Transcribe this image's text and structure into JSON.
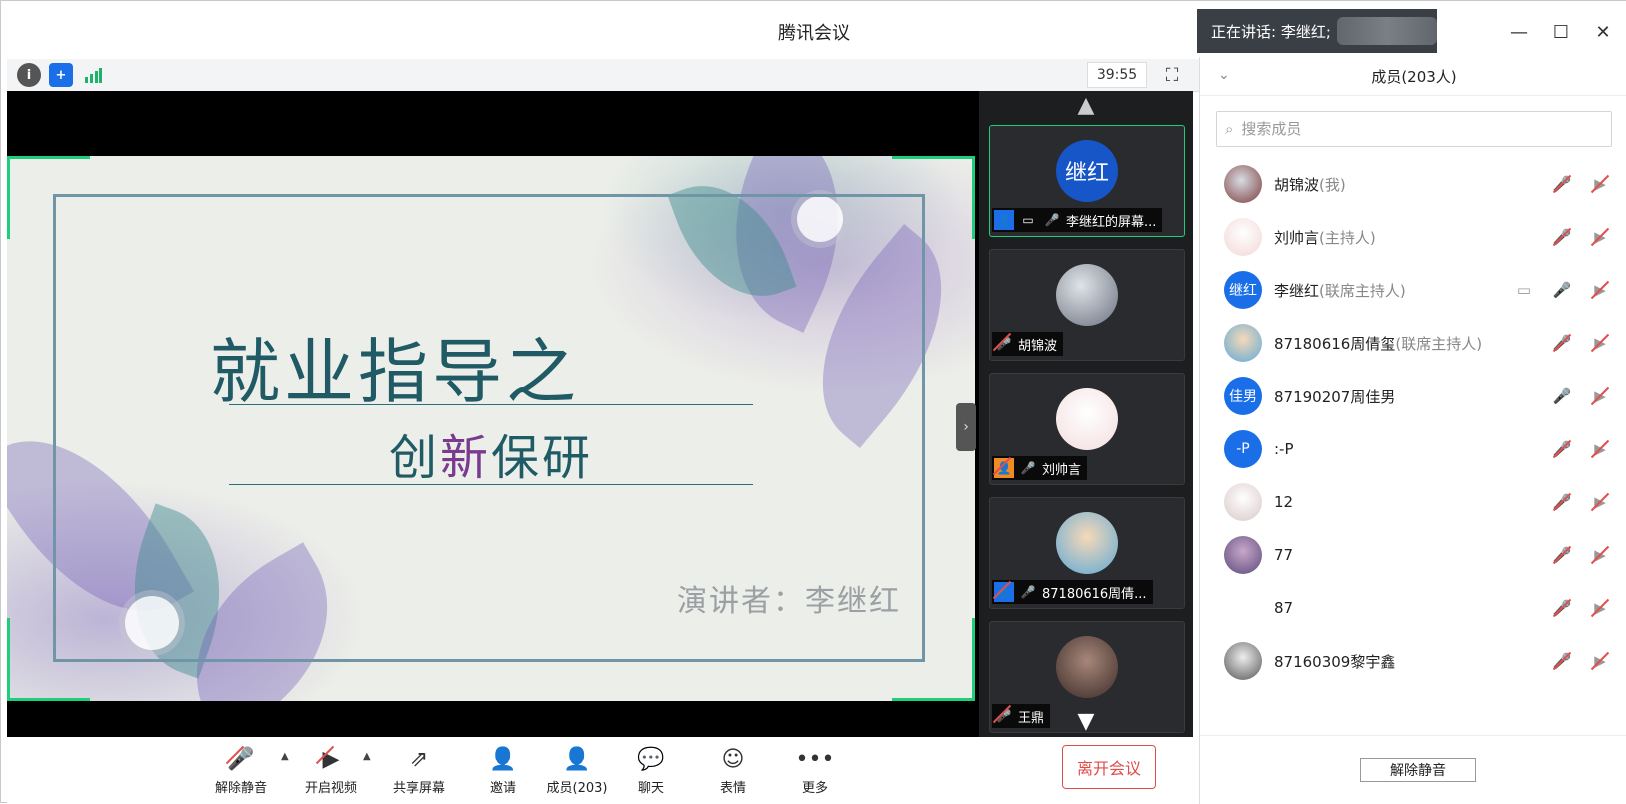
{
  "app": {
    "title": "腾讯会议"
  },
  "speaking": {
    "label": "正在讲话: 李继红;"
  },
  "toolbar": {
    "timer": "39:55"
  },
  "slide": {
    "title": "就业指导之",
    "subtitle_a": "创",
    "subtitle_accent": "新",
    "subtitle_b": "保研",
    "presenter": "演讲者：李继红"
  },
  "gallery": {
    "tiles": [
      {
        "avatar_text": "继红",
        "label": "李继红的屏幕..."
      },
      {
        "avatar_text": "",
        "label": "胡锦波"
      },
      {
        "avatar_text": "",
        "label": "刘帅言"
      },
      {
        "avatar_text": "",
        "label": "87180616周倩..."
      },
      {
        "avatar_text": "",
        "label": "王鼎"
      }
    ]
  },
  "panel": {
    "title": "成员(203人)",
    "search_placeholder": "搜索成员",
    "members": [
      {
        "avatar_text": "",
        "name": "胡锦波",
        "role": "(我)"
      },
      {
        "avatar_text": "",
        "name": "刘帅言",
        "role": "(主持人)"
      },
      {
        "avatar_text": "继红",
        "name": "李继红",
        "role": "(联席主持人)"
      },
      {
        "avatar_text": "",
        "name": "87180616周倩玺",
        "role": "(联席主持人)"
      },
      {
        "avatar_text": "佳男",
        "name": "87190207周佳男",
        "role": ""
      },
      {
        "avatar_text": "-P",
        "name": ":-P",
        "role": ""
      },
      {
        "avatar_text": "",
        "name": "12",
        "role": ""
      },
      {
        "avatar_text": "",
        "name": "77",
        "role": ""
      },
      {
        "avatar_text": "",
        "name": "87",
        "role": ""
      },
      {
        "avatar_text": "",
        "name": "87160309黎宇鑫",
        "role": ""
      }
    ],
    "unmute_all": "解除静音"
  },
  "controls": {
    "unmute": "解除静音",
    "start_video": "开启视频",
    "share_screen": "共享屏幕",
    "invite": "邀请",
    "members": "成员(203)",
    "chat": "聊天",
    "reactions": "表情",
    "more": "更多",
    "leave": "离开会议"
  },
  "colors": {
    "accent_green": "#1fce7a",
    "leave_red": "#e24a4a",
    "brand_blue": "#1a6fe8"
  }
}
